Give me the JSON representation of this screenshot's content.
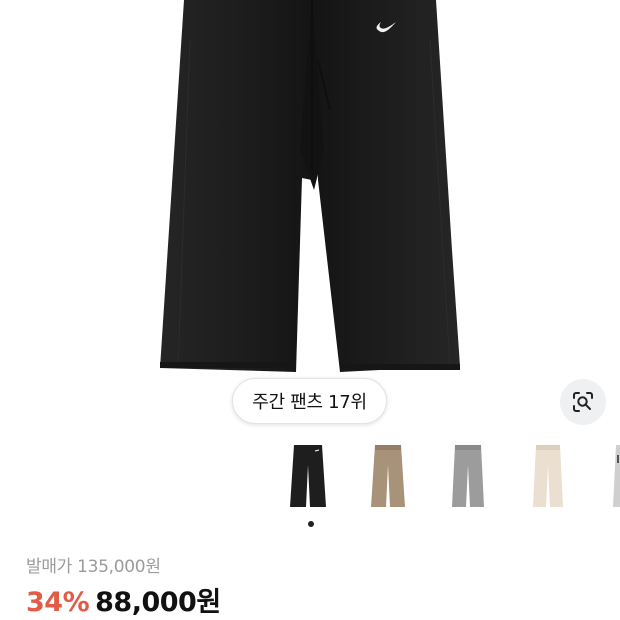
{
  "product": {
    "image_alt": "black wide-leg sweatpants",
    "rank_label": "주간 팬츠 17위",
    "original_price": "발매가 135,000원",
    "discount": "34%",
    "price": "88,000원"
  },
  "gallery": {
    "thumbnails": [
      {
        "name": "black",
        "color": "#1e1e1e"
      },
      {
        "name": "khaki",
        "color": "#a8937a"
      },
      {
        "name": "grey",
        "color": "#9c9c9c"
      },
      {
        "name": "cream",
        "color": "#eadfd0"
      },
      {
        "name": "light-grey",
        "color": "#cfcfcf"
      }
    ],
    "active_index": 0
  },
  "colors": {
    "discount": "#e25b46",
    "pants": "#1d1d1d",
    "swoosh": "#ffffff"
  },
  "icons": {
    "lens": "visual-search-icon",
    "swoosh": "swoosh-logo-icon"
  }
}
